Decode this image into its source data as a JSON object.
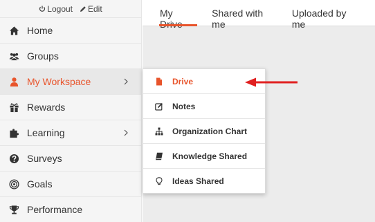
{
  "top_links": {
    "logout": "Logout",
    "edit": "Edit"
  },
  "sidebar": {
    "items": [
      {
        "label": "Home"
      },
      {
        "label": "Groups"
      },
      {
        "label": "My Workspace"
      },
      {
        "label": "Rewards"
      },
      {
        "label": "Learning"
      },
      {
        "label": "Surveys"
      },
      {
        "label": "Goals"
      },
      {
        "label": "Performance"
      }
    ]
  },
  "tabs": [
    {
      "label": "My Drive"
    },
    {
      "label": "Shared with me"
    },
    {
      "label": "Uploaded by me"
    }
  ],
  "submenu": {
    "items": [
      {
        "label": "Drive"
      },
      {
        "label": "Notes"
      },
      {
        "label": "Organization Chart"
      },
      {
        "label": "Knowledge Shared"
      },
      {
        "label": "Ideas Shared"
      }
    ]
  },
  "colors": {
    "accent": "#e8542b",
    "annotation": "#e02020"
  }
}
